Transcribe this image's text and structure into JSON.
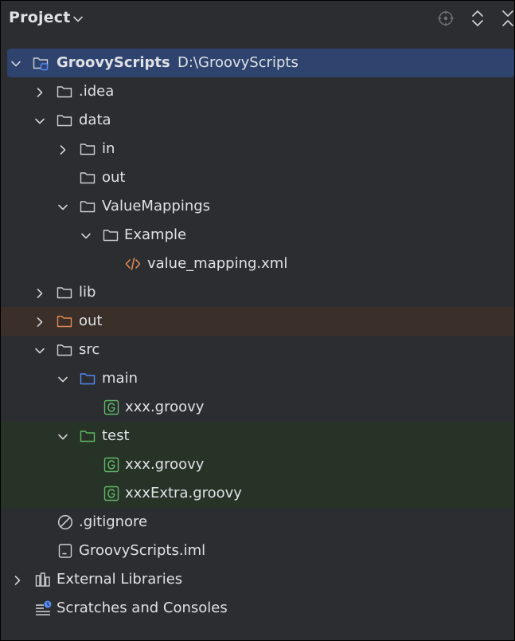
{
  "panel": {
    "title": "Project"
  },
  "colors": {
    "background": "#2B2D30",
    "selected": "#2E436E",
    "excluded": "#3B3029",
    "test_root": "#283328",
    "folder": "#CED0D6",
    "source_folder": "#548AF7",
    "test_folder": "#5FB865",
    "excluded_folder": "#E08855",
    "xml_icon": "#E08855",
    "groovy_icon": "#5FB865"
  },
  "tree": {
    "root": {
      "name": "GroovyScripts",
      "path": "D:\\GroovyScripts",
      "icon": "module-folder-icon"
    },
    "idea": {
      "name": ".idea",
      "icon": "folder-icon"
    },
    "data": {
      "name": "data",
      "icon": "folder-icon"
    },
    "data_in": {
      "name": "in",
      "icon": "folder-icon"
    },
    "data_out": {
      "name": "out",
      "icon": "folder-icon"
    },
    "value_mappings": {
      "name": "ValueMappings",
      "icon": "folder-icon"
    },
    "example": {
      "name": "Example",
      "icon": "folder-icon"
    },
    "value_mapping_xml": {
      "name": "value_mapping.xml",
      "icon": "xml-icon"
    },
    "lib": {
      "name": "lib",
      "icon": "folder-icon"
    },
    "out": {
      "name": "out",
      "icon": "excluded-folder-icon"
    },
    "src": {
      "name": "src",
      "icon": "folder-icon"
    },
    "main": {
      "name": "main",
      "icon": "source-folder-icon"
    },
    "main_xxx": {
      "name": "xxx.groovy",
      "icon": "groovy-icon"
    },
    "test": {
      "name": "test",
      "icon": "test-folder-icon"
    },
    "test_xxx": {
      "name": "xxx.groovy",
      "icon": "groovy-icon"
    },
    "test_xxx_extra": {
      "name": "xxxExtra.groovy",
      "icon": "groovy-icon"
    },
    "gitignore": {
      "name": ".gitignore",
      "icon": "ignored-file-icon"
    },
    "iml": {
      "name": "GroovyScripts.iml",
      "icon": "iml-file-icon"
    },
    "external_libraries": {
      "name": "External Libraries",
      "icon": "libraries-icon"
    },
    "scratches": {
      "name": "Scratches and Consoles",
      "icon": "scratches-icon"
    }
  }
}
